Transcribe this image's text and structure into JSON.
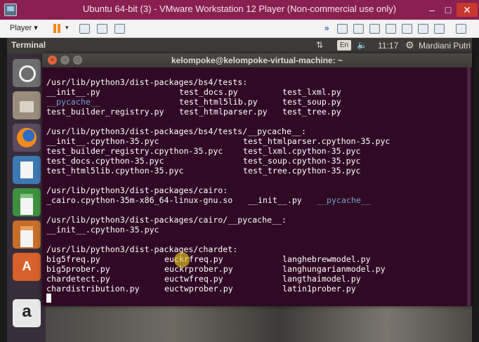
{
  "vm": {
    "title": "Ubuntu 64-bit (3) - VMware Workstation 12 Player (Non-commercial use only)",
    "min_glyph": "–",
    "max_glyph": "□",
    "close_glyph": "✕",
    "player_menu": "Player ▾",
    "pause_dropdown": "▾",
    "toolbar_chevron": "»"
  },
  "panel": {
    "app_name": "Terminal",
    "sort_glyph": "⇅",
    "keyboard": "En",
    "volume_glyph": "🔈",
    "clock": "11:17",
    "gear_glyph": "⚙",
    "user": "Mardiani Putri"
  },
  "terminal": {
    "title": "kelompoke@kelompoke-virtual-machine: ~",
    "lines": [
      {
        "cells": [
          {
            "t": "/usr/lib/python3/dist-packages/bs4/tests:",
            "c": 0
          }
        ]
      },
      {
        "cells": [
          {
            "t": "__init__.py",
            "c": 0
          },
          {
            "t": "test_docs.py",
            "c": 27
          },
          {
            "t": "test_lxml.py",
            "c": 48
          }
        ]
      },
      {
        "cells": [
          {
            "t": "__pycache__",
            "c": 0,
            "dir": true
          },
          {
            "t": "test_html5lib.py",
            "c": 27
          },
          {
            "t": "test_soup.py",
            "c": 48
          }
        ]
      },
      {
        "cells": [
          {
            "t": "test_builder_registry.py",
            "c": 0
          },
          {
            "t": "test_htmlparser.py",
            "c": 27
          },
          {
            "t": "test_tree.py",
            "c": 48
          }
        ]
      },
      {
        "cells": []
      },
      {
        "cells": [
          {
            "t": "/usr/lib/python3/dist-packages/bs4/tests/__pycache__:",
            "c": 0
          }
        ]
      },
      {
        "cells": [
          {
            "t": "__init__.cpython-35.pyc",
            "c": 0
          },
          {
            "t": "test_htmlparser.cpython-35.pyc",
            "c": 40
          }
        ]
      },
      {
        "cells": [
          {
            "t": "test_builder_registry.cpython-35.pyc",
            "c": 0
          },
          {
            "t": "test_lxml.cpython-35.pyc",
            "c": 40
          }
        ]
      },
      {
        "cells": [
          {
            "t": "test_docs.cpython-35.pyc",
            "c": 0
          },
          {
            "t": "test_soup.cpython-35.pyc",
            "c": 40
          }
        ]
      },
      {
        "cells": [
          {
            "t": "test_html5lib.cpython-35.pyc",
            "c": 0
          },
          {
            "t": "test_tree.cpython-35.pyc",
            "c": 40
          }
        ]
      },
      {
        "cells": []
      },
      {
        "cells": [
          {
            "t": "/usr/lib/python3/dist-packages/cairo:",
            "c": 0
          }
        ]
      },
      {
        "cells": [
          {
            "t": "_cairo.cpython-35m-x86_64-linux-gnu.so",
            "c": 0
          },
          {
            "t": "__init__.py",
            "c": 41
          },
          {
            "t": "__pycache__",
            "c": 55,
            "dir": true
          }
        ]
      },
      {
        "cells": []
      },
      {
        "cells": [
          {
            "t": "/usr/lib/python3/dist-packages/cairo/__pycache__:",
            "c": 0
          }
        ]
      },
      {
        "cells": [
          {
            "t": "__init__.cpython-35.pyc",
            "c": 0
          }
        ]
      },
      {
        "cells": []
      },
      {
        "cells": [
          {
            "t": "/usr/lib/python3/dist-packages/chardet:",
            "c": 0
          }
        ]
      },
      {
        "cells": [
          {
            "t": "big5freq.py",
            "c": 0
          },
          {
            "t": "euckrfreq.py",
            "c": 24
          },
          {
            "t": "langhebrewmodel.py",
            "c": 48
          }
        ]
      },
      {
        "cells": [
          {
            "t": "big5prober.py",
            "c": 0
          },
          {
            "t": "euckrprober.py",
            "c": 24
          },
          {
            "t": "langhungarianmodel.py",
            "c": 48
          }
        ]
      },
      {
        "cells": [
          {
            "t": "chardetect.py",
            "c": 0
          },
          {
            "t": "euctwfreq.py",
            "c": 24
          },
          {
            "t": "langthaimodel.py",
            "c": 48
          }
        ]
      },
      {
        "cells": [
          {
            "t": "chardistribution.py",
            "c": 0
          },
          {
            "t": "euctwprober.py",
            "c": 24
          },
          {
            "t": "latin1prober.py",
            "c": 48
          }
        ]
      }
    ]
  },
  "colors": {
    "terminal_bg": "#300a24",
    "directory_blue": "#729fcf",
    "vm_titlebar": "#8a2050"
  }
}
